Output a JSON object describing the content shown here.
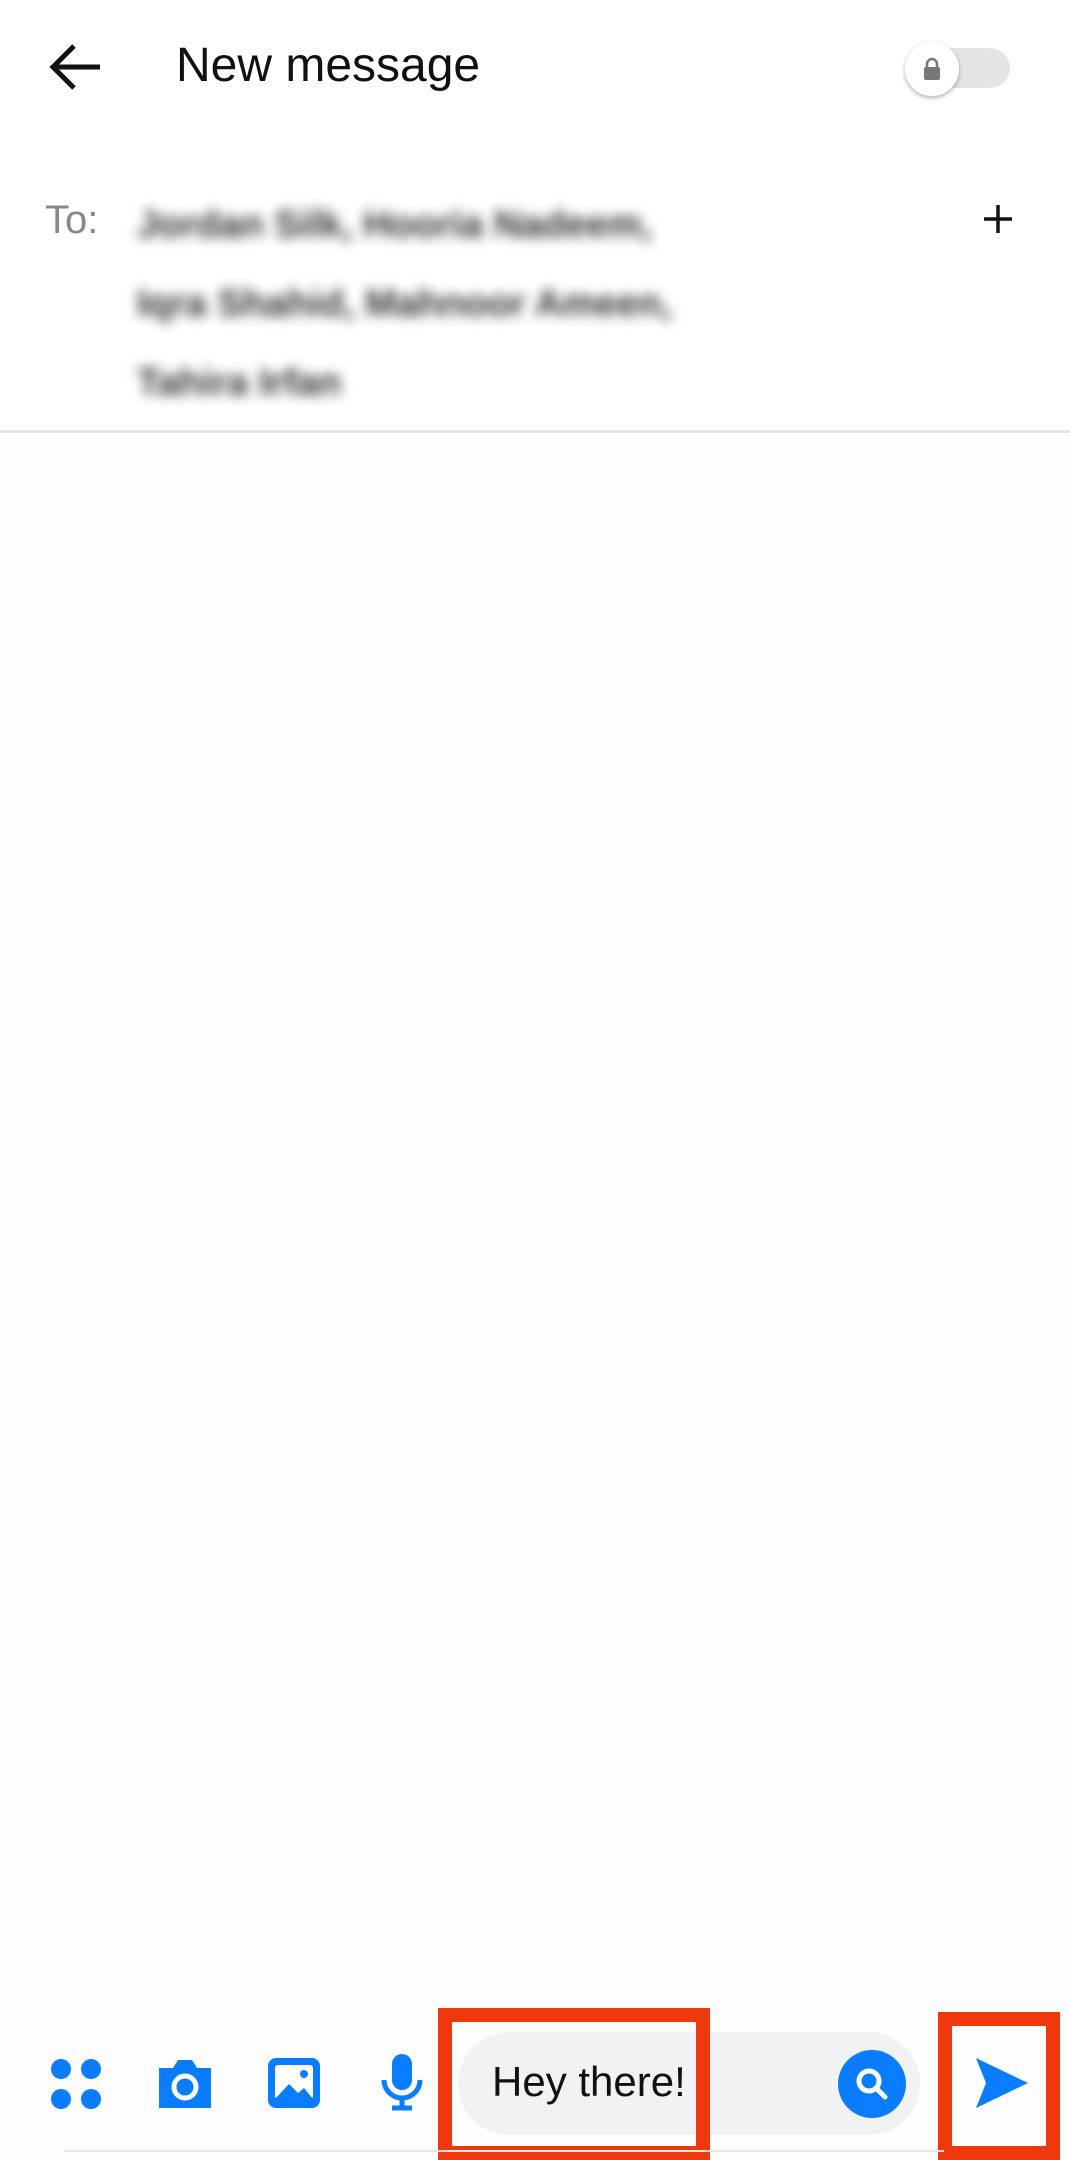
{
  "header": {
    "title": "New message",
    "back_icon": "arrow-left-icon",
    "secret_toggle": {
      "icon": "lock-icon",
      "on": false
    }
  },
  "recipients": {
    "label": "To:",
    "names": [
      "Jordan Silk, Hooria Nadeem,",
      "Iqra Shahid, Mahnoor Ameen,",
      "Tahira Irfan"
    ],
    "add_icon": "plus-icon"
  },
  "composer": {
    "message_value": "Hey there!",
    "icons": [
      "apps-icon",
      "camera-icon",
      "image-icon",
      "microphone-icon",
      "search-icon",
      "send-icon"
    ]
  },
  "colors": {
    "accent": "#0a7cff",
    "highlight": "#f0380f"
  }
}
